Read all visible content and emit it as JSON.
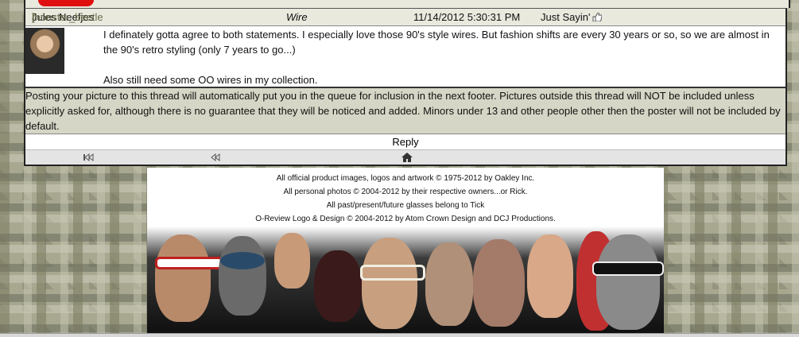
{
  "post": {
    "username_handle": "monster_beetle",
    "bracket_open": "[",
    "bracket_close": "]",
    "display_name": "Jules Neefjes",
    "title": "Wire",
    "timestamp": "11/14/2012 5:30:31 PM",
    "tag": "Just Sayin'",
    "tag_icon": "thumbs-up-icon",
    "body_paragraphs": [
      "I definately gotta agree to both statements. I especially love those 90's style wires. But fashion shifts are every 30 years or so, so we are almost in the 90's retro styling (only 7 years to go...)",
      "Also still need some OO wires in my collection."
    ]
  },
  "notice": "Posting your picture to this thread will automatically put you in the queue for inclusion in the next footer. Pictures outside this thread will NOT be included unless explicitly asked for, although there is no guarantee that they will be noticed and added. Minors under 13 and other people other then the poster will not be included by default.",
  "reply_label": "Reply",
  "nav": {
    "first_icon": "skip-to-first-icon",
    "prev_icon": "rewind-icon",
    "home_icon": "home-icon"
  },
  "footer": {
    "credits": [
      "All official product images, logos and artwork © 1975-2012 by Oakley Inc.",
      "All personal photos © 2004-2012 by their respective owners...or Rick.",
      "All past/present/future glasses belong to Tick",
      "O-Review Logo & Design © 2004-2012 by Atom Crown Design and DCJ Productions."
    ]
  },
  "colors": {
    "header_bg": "#e9e9de",
    "notice_bg": "#d6d6c6",
    "handle_color": "#6b6b4a"
  }
}
